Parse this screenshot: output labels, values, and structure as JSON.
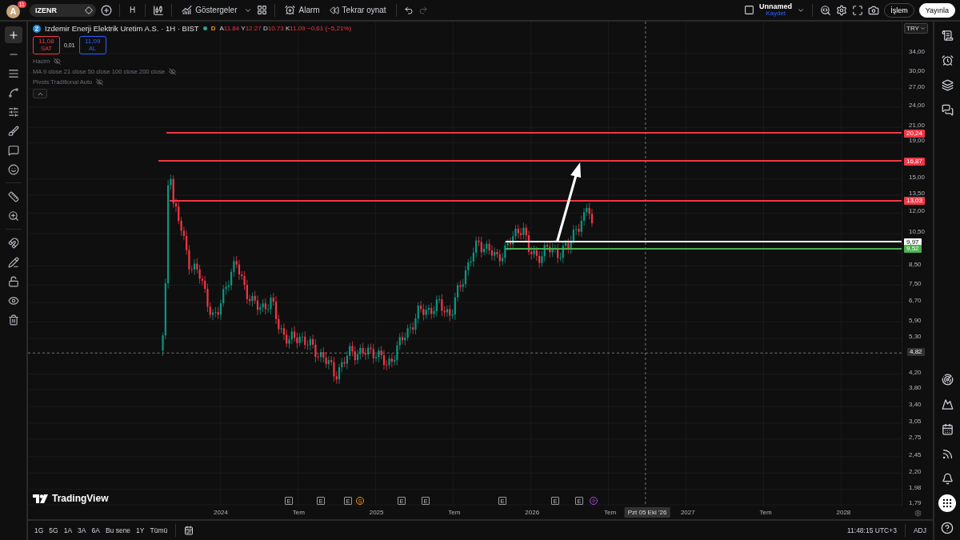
{
  "top_bar": {
    "avatar": {
      "letter": "A",
      "badge": "11"
    },
    "symbol": "IZENR",
    "interval": "H",
    "indicators_label": "Göstergeler",
    "alarm_label": "Alarm",
    "replay_label": "Tekrar oynat",
    "layout": {
      "name": "Unnamed",
      "status": "Kaydet"
    },
    "trade_button": "İşlem",
    "publish_button": "Yayınla"
  },
  "left_toolbar": [
    {
      "selected": true
    },
    {
      "selected": false
    },
    {
      "selected": false
    },
    {
      "selected": false
    },
    {
      "selected": false
    },
    {
      "selected": false
    },
    {
      "selected": false
    },
    {
      "selected": false
    },
    {
      "selected": false
    },
    {
      "selected": false
    },
    {
      "selected": false
    },
    {
      "selected": false
    },
    {
      "selected": false
    },
    {
      "selected": false
    },
    {
      "selected": false
    }
  ],
  "legend": {
    "title": "Izdemir Enerji Elektrik Uretim A.S. · 1H · BIST",
    "session_badge": "D",
    "ohlc": [
      {
        "key": "A",
        "value": "11.84"
      },
      {
        "key": "Y",
        "value": "12.27"
      },
      {
        "key": "D",
        "value": "10.73"
      },
      {
        "key": "K",
        "value": "11.09"
      }
    ],
    "change": "−0,61 (−5,21%)",
    "sell": {
      "price": "11,08",
      "label": "SAT"
    },
    "spread": "0,01",
    "buy": {
      "price": "11,09",
      "label": "AL"
    },
    "indicators": [
      {
        "name": "Hacim",
        "visible": false
      },
      {
        "name": "MA 9 close 21 close 50 close 100 close 200 close",
        "visible": false
      },
      {
        "name": "Pivots Traditional Auto",
        "visible": false
      }
    ]
  },
  "price_axis": {
    "currency": "TRY",
    "ticks": [
      "34,00",
      "30,00",
      "27,00",
      "24,00",
      "21,00",
      "19,00",
      "15,00",
      "13,50",
      "12,00",
      "10,50",
      "8,50",
      "7,50",
      "6,70",
      "5,90",
      "5,30",
      "4,20",
      "3,80",
      "3,40",
      "3,05",
      "2,75",
      "2,45",
      "2,20",
      "1,98",
      "1,79"
    ]
  },
  "price_lines": [
    {
      "price": "20,24",
      "color": "#f23645"
    },
    {
      "price": "16,87",
      "color": "#f23645"
    },
    {
      "price": "13,03",
      "color": "#f23645"
    },
    {
      "price": "9,97",
      "color": "#ffffff"
    },
    {
      "price": "9,52",
      "color": "#4caf50"
    }
  ],
  "crosshair": {
    "price": "4,82",
    "date": "Pzt 05 Eki '26"
  },
  "events": [
    {
      "kind": "letter",
      "label": "E"
    },
    {
      "kind": "letter",
      "label": "E"
    },
    {
      "kind": "letter",
      "label": "E"
    },
    {
      "kind": "round",
      "label": "S"
    },
    {
      "kind": "letter",
      "label": "E"
    },
    {
      "kind": "letter",
      "label": "E"
    },
    {
      "kind": "letter",
      "label": "E"
    },
    {
      "kind": "letter",
      "label": "E"
    },
    {
      "kind": "letter",
      "label": "E"
    },
    {
      "kind": "bolt"
    }
  ],
  "time_axis": [
    "2024",
    "Tem",
    "2025",
    "Tem",
    "2026",
    "Tem",
    "2027",
    "Tem",
    "2028"
  ],
  "logo": "TradingView",
  "bottom_bar": {
    "ranges": [
      "1G",
      "5G",
      "1A",
      "3A",
      "6A",
      "Bu sene",
      "1Y",
      "Tümü"
    ],
    "time": "11:48:15 UTC+3",
    "adj": "ADJ"
  }
}
